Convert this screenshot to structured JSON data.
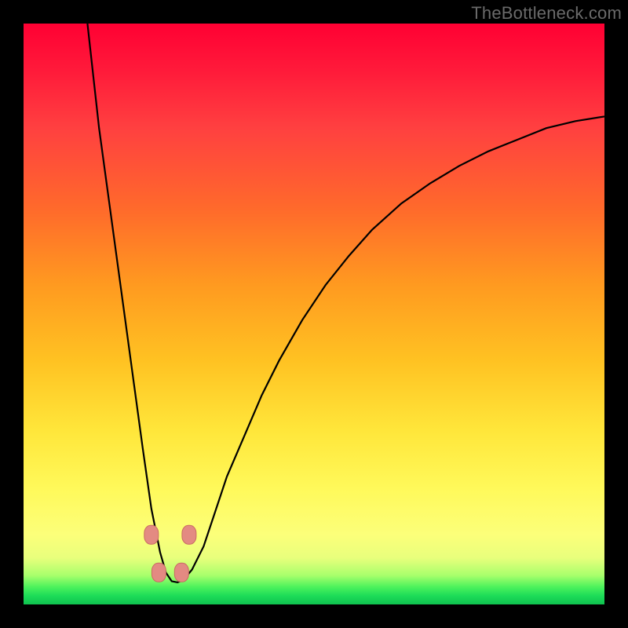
{
  "watermark": "TheBottleneck.com",
  "colors": {
    "frame": "#000000",
    "curve": "#000000",
    "markers_fill": "#e38a82",
    "markers_stroke": "#c96b63"
  },
  "chart_data": {
    "type": "line",
    "title": "",
    "xlabel": "",
    "ylabel": "",
    "xlim": [
      0,
      100
    ],
    "ylim": [
      0,
      100
    ],
    "grid": false,
    "legend": false,
    "x": [
      11,
      12,
      13,
      14.5,
      16,
      17.5,
      19,
      20.5,
      22,
      23.5,
      24.5,
      25.5,
      26.5,
      27.5,
      29,
      31,
      33,
      35,
      38,
      41,
      44,
      48,
      52,
      56,
      60,
      65,
      70,
      75,
      80,
      85,
      90,
      95,
      100
    ],
    "values": [
      100,
      91,
      82,
      71,
      60,
      49,
      38,
      27,
      16.5,
      9,
      5.5,
      4,
      3.8,
      4.2,
      6,
      10,
      16,
      22,
      29,
      36,
      42,
      49,
      55,
      60,
      64.5,
      69,
      72.5,
      75.5,
      78,
      80,
      82,
      83.2,
      84
    ],
    "markers": [
      {
        "x": 22.0,
        "y": 12
      },
      {
        "x": 28.5,
        "y": 12
      },
      {
        "x": 23.3,
        "y": 5.5
      },
      {
        "x": 27.2,
        "y": 5.5
      }
    ]
  }
}
